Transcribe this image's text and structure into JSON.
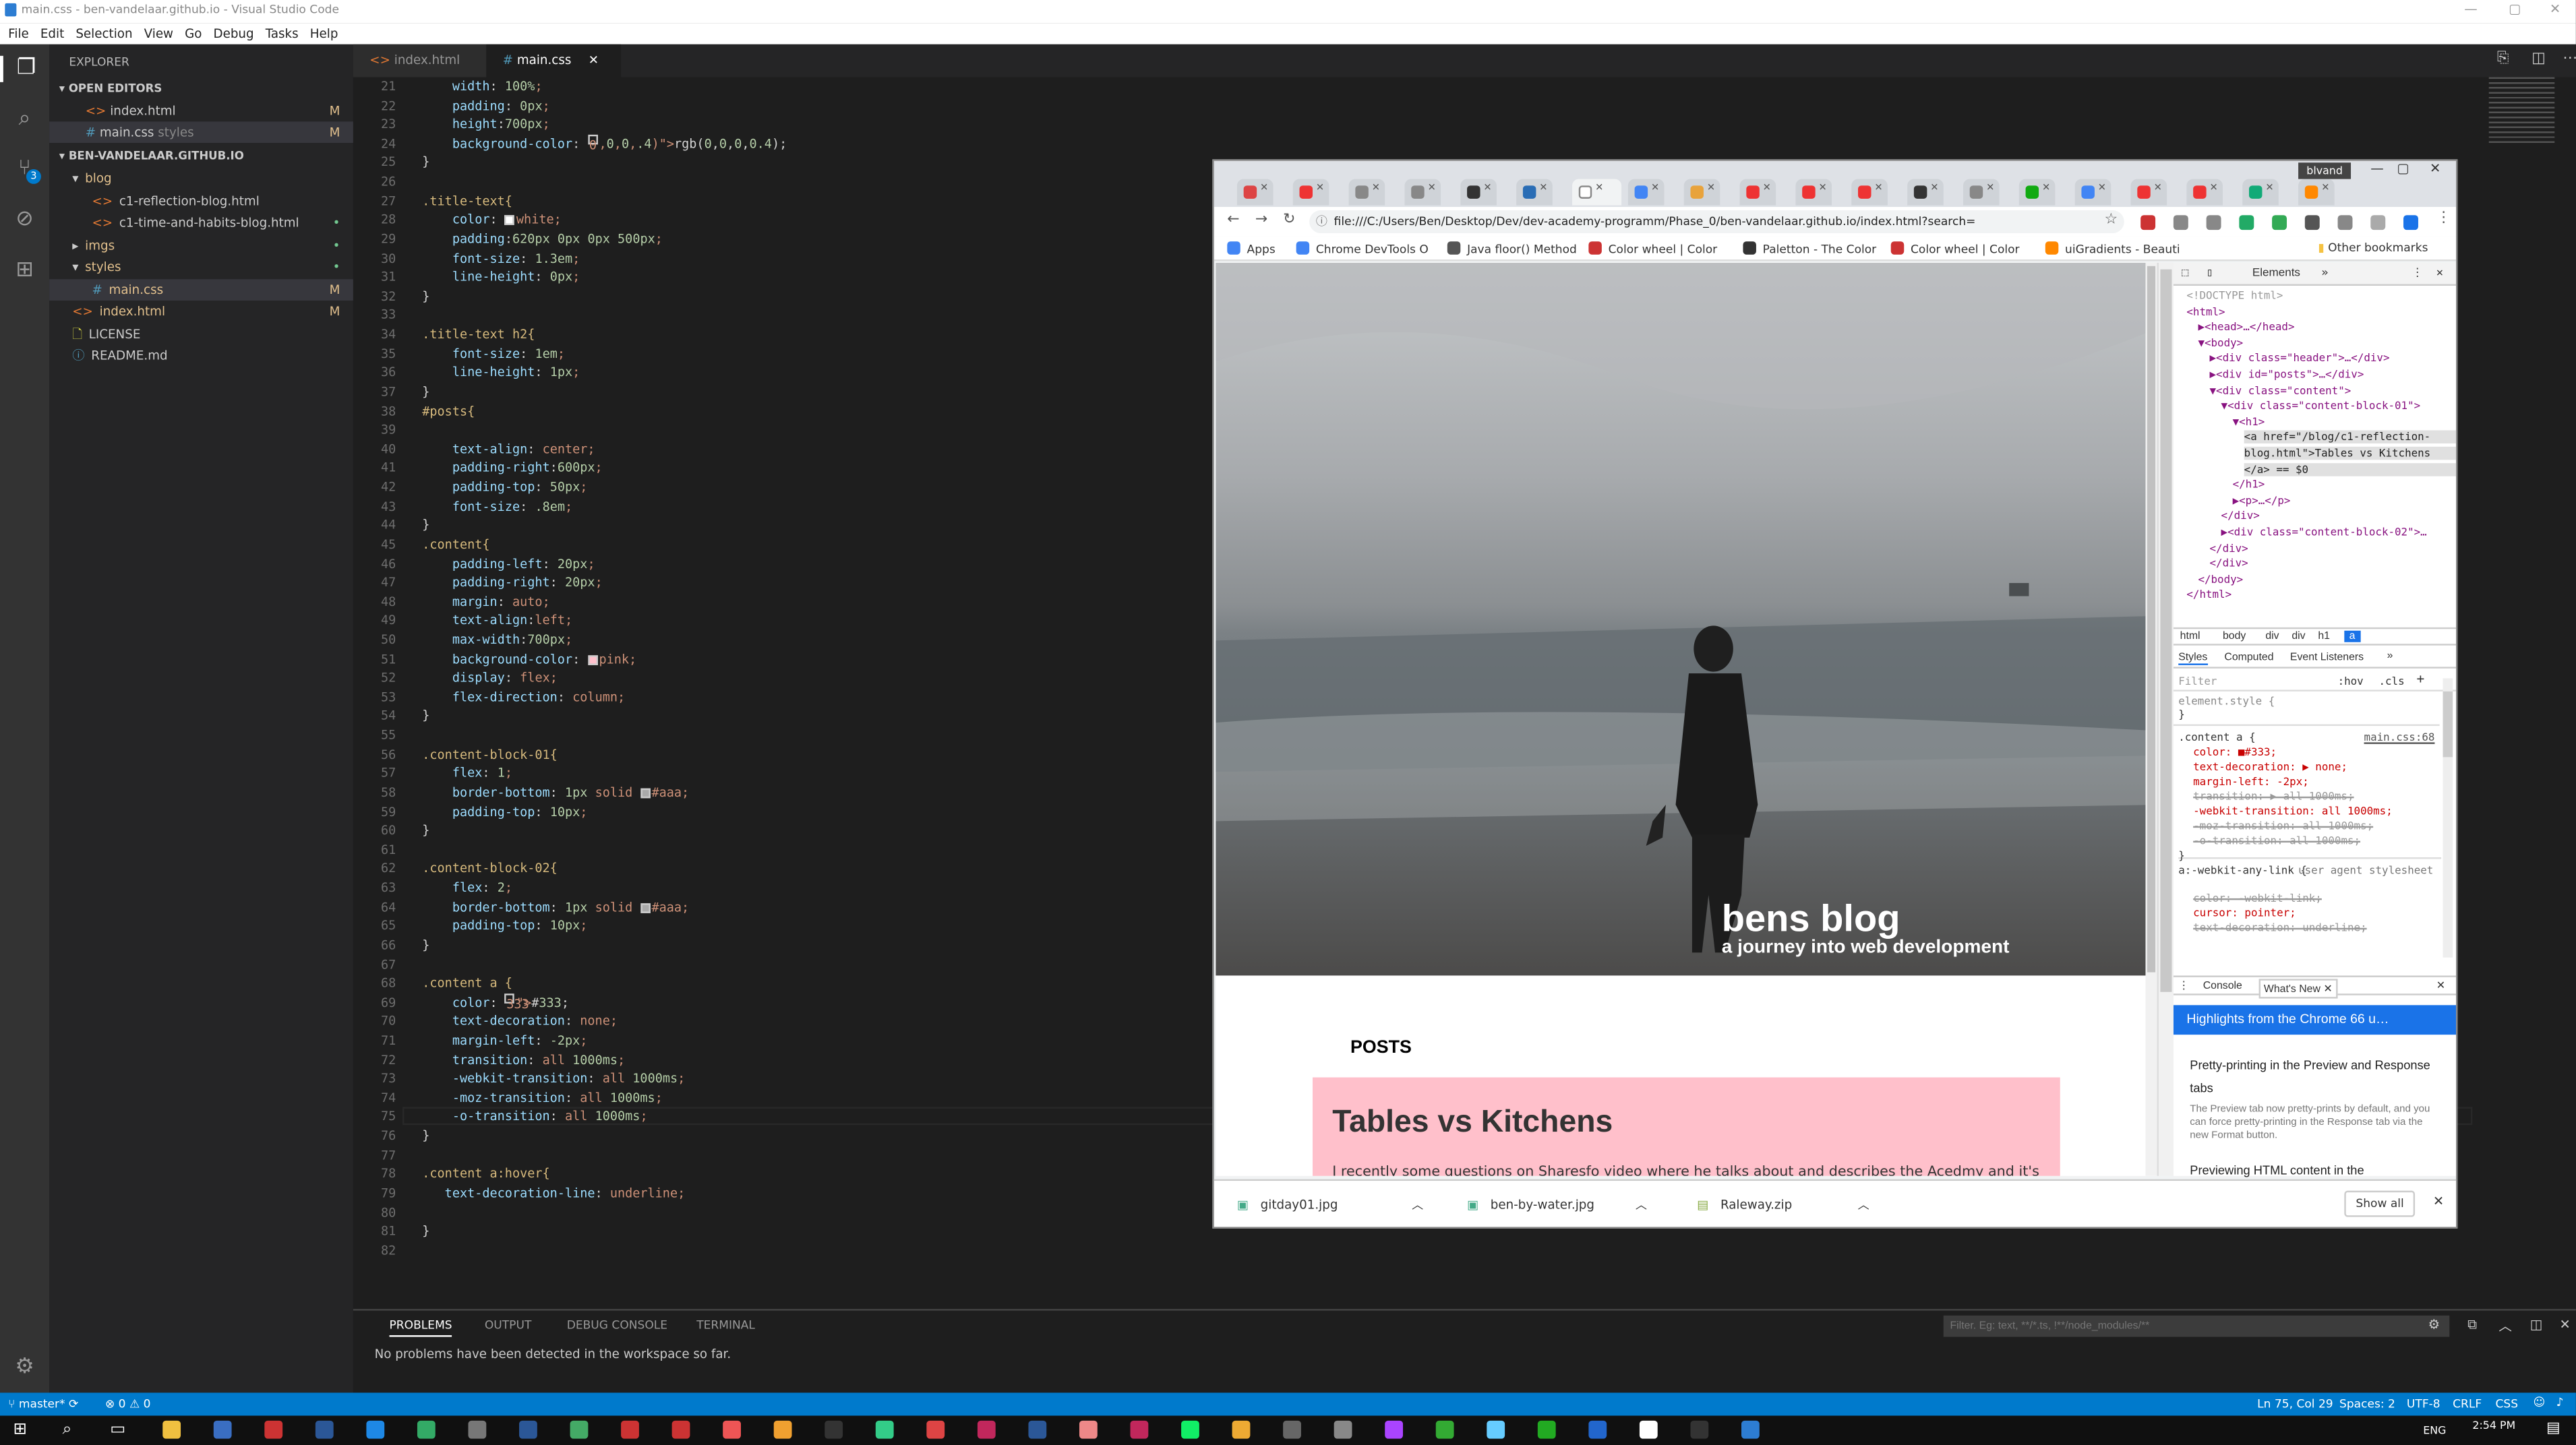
{
  "window": {
    "title": "main.css - ben-vandelaar.github.io - Visual Studio Code"
  },
  "menu": [
    "File",
    "Edit",
    "Selection",
    "View",
    "Go",
    "Debug",
    "Tasks",
    "Help"
  ],
  "sidebar": {
    "header": "EXPLORER",
    "open_editors_label": "OPEN EDITORS",
    "open_editors": [
      {
        "name": "index.html",
        "badge": "M"
      },
      {
        "name": "main.css",
        "hint": "styles",
        "badge": "M"
      }
    ],
    "project_label": "BEN-VANDELAAR.GITHUB.IO",
    "tree": [
      {
        "name": "blog",
        "kind": "folder",
        "depth": 0,
        "badge": ""
      },
      {
        "name": "c1-reflection-blog.html",
        "kind": "html",
        "depth": 1,
        "badge": ""
      },
      {
        "name": "c1-time-and-habits-blog.html",
        "kind": "html",
        "depth": 1,
        "badge": "•"
      },
      {
        "name": "imgs",
        "kind": "folder",
        "depth": 0,
        "badge": "•"
      },
      {
        "name": "styles",
        "kind": "folder",
        "depth": 0,
        "badge": "•"
      },
      {
        "name": "main.css",
        "kind": "css",
        "depth": 1,
        "badge": "M"
      },
      {
        "name": "index.html",
        "kind": "html",
        "depth": 0,
        "badge": "M"
      },
      {
        "name": "LICENSE",
        "kind": "file",
        "depth": 0,
        "badge": ""
      },
      {
        "name": "README.md",
        "kind": "md",
        "depth": 0,
        "badge": ""
      }
    ]
  },
  "editor": {
    "tabs": [
      {
        "label": "index.html",
        "active": false
      },
      {
        "label": "main.css",
        "active": true
      }
    ],
    "lines": [
      {
        "n": "21",
        "t": "    width: 100%;"
      },
      {
        "n": "22",
        "t": "    padding: 0px;"
      },
      {
        "n": "23",
        "t": "    height:700px;"
      },
      {
        "n": "24",
        "t": "    background-color: ■rgb(0,0,0,0.4);"
      },
      {
        "n": "25",
        "t": "}"
      },
      {
        "n": "26",
        "t": ""
      },
      {
        "n": "27",
        "t": ".title-text{"
      },
      {
        "n": "28",
        "t": "    color: □white;"
      },
      {
        "n": "29",
        "t": "    padding:620px 0px 0px 500px;"
      },
      {
        "n": "30",
        "t": "    font-size: 1.3em;"
      },
      {
        "n": "31",
        "t": "    line-height: 0px;"
      },
      {
        "n": "32",
        "t": "}"
      },
      {
        "n": "33",
        "t": ""
      },
      {
        "n": "34",
        "t": ".title-text h2{"
      },
      {
        "n": "35",
        "t": "    font-size: 1em;"
      },
      {
        "n": "36",
        "t": "    line-height: 1px;"
      },
      {
        "n": "37",
        "t": "}"
      },
      {
        "n": "38",
        "t": "#posts{"
      },
      {
        "n": "39",
        "t": ""
      },
      {
        "n": "40",
        "t": "    text-align: center;"
      },
      {
        "n": "41",
        "t": "    padding-right:600px;"
      },
      {
        "n": "42",
        "t": "    padding-top: 50px;"
      },
      {
        "n": "43",
        "t": "    font-size: .8em;"
      },
      {
        "n": "44",
        "t": "}"
      },
      {
        "n": "45",
        "t": ".content{"
      },
      {
        "n": "46",
        "t": "    padding-left: 20px;"
      },
      {
        "n": "47",
        "t": "    padding-right: 20px;"
      },
      {
        "n": "48",
        "t": "    margin: auto;"
      },
      {
        "n": "49",
        "t": "    text-align:left;"
      },
      {
        "n": "50",
        "t": "    max-width:700px;"
      },
      {
        "n": "51",
        "t": "    background-color: □pink;"
      },
      {
        "n": "52",
        "t": "    display: flex;"
      },
      {
        "n": "53",
        "t": "    flex-direction: column;"
      },
      {
        "n": "54",
        "t": "}"
      },
      {
        "n": "55",
        "t": ""
      },
      {
        "n": "56",
        "t": ".content-block-01{"
      },
      {
        "n": "57",
        "t": "    flex: 1;"
      },
      {
        "n": "58",
        "t": "    border-bottom: 1px solid □#aaa;"
      },
      {
        "n": "59",
        "t": "    padding-top: 10px;"
      },
      {
        "n": "60",
        "t": "}"
      },
      {
        "n": "61",
        "t": ""
      },
      {
        "n": "62",
        "t": ".content-block-02{"
      },
      {
        "n": "63",
        "t": "    flex: 2;"
      },
      {
        "n": "64",
        "t": "    border-bottom: 1px solid □#aaa;"
      },
      {
        "n": "65",
        "t": "    padding-top: 10px;"
      },
      {
        "n": "66",
        "t": "}"
      },
      {
        "n": "67",
        "t": ""
      },
      {
        "n": "68",
        "t": ".content a {"
      },
      {
        "n": "69",
        "t": "    color: □#333;"
      },
      {
        "n": "70",
        "t": "    text-decoration: none;"
      },
      {
        "n": "71",
        "t": "    margin-left: -2px;"
      },
      {
        "n": "72",
        "t": "    transition: all 1000ms;"
      },
      {
        "n": "73",
        "t": "    -webkit-transition: all 1000ms;"
      },
      {
        "n": "74",
        "t": "    -moz-transition: all 1000ms;"
      },
      {
        "n": "75",
        "t": "    -o-transition: all 1000ms;"
      },
      {
        "n": "76",
        "t": "}"
      },
      {
        "n": "77",
        "t": ""
      },
      {
        "n": "78",
        "t": ".content a:hover{"
      },
      {
        "n": "79",
        "t": "   text-decoration-line: underline;"
      },
      {
        "n": "80",
        "t": ""
      },
      {
        "n": "81",
        "t": "}"
      },
      {
        "n": "82",
        "t": ""
      }
    ]
  },
  "panel": {
    "tabs": [
      "PROBLEMS",
      "OUTPUT",
      "DEBUG CONSOLE",
      "TERMINAL"
    ],
    "message": "No problems have been detected in the workspace so far.",
    "filter_placeholder": "Filter. Eg: text, **/*.ts, !**/node_modules/**"
  },
  "statusbar": {
    "branch": "master*",
    "problems": "⊗ 0 ⚠ 0",
    "position": "Ln 75, Col 29",
    "spaces": "Spaces: 2",
    "encoding": "UTF-8",
    "eol": "CRLF",
    "language": "CSS"
  },
  "taskbar": {
    "time": "2:54 PM",
    "lang": "ENG"
  },
  "chrome": {
    "profile": "blvand",
    "url": "file:///C:/Users/Ben/Desktop/Dev/dev-academy-programm/Phase_0/ben-vandelaar.github.io/index.html?search=",
    "bookmarks": [
      "Apps",
      "Chrome DevTools O",
      "Java floor() Method",
      "Color wheel | Color",
      "Paletton - The Color",
      "Color wheel | Color",
      "uiGradients - Beauti"
    ],
    "other_bookmarks": "Other bookmarks",
    "page": {
      "title": "bens blog",
      "subtitle": "a journey into web development",
      "posts_heading": "POSTS",
      "post_title": "Tables vs Kitchens",
      "post_snippet": "I recently some questions on Sharesfo video where he talks about and describes the Acedmy and it's"
    },
    "downloads": [
      "gitday01.jpg",
      "ben-by-water.jpg",
      "Raleway.zip"
    ],
    "show_all": "Show all"
  },
  "devtools": {
    "tab": "Elements",
    "dom": [
      "<!DOCTYPE html>",
      "<html>",
      "▶<head>…</head>",
      "▼<body>",
      "▶<div class=\"header\">…</div>",
      "▶<div id=\"posts\">…</div>",
      "▼<div class=\"content\">",
      "▼<div class=\"content-block-01\">",
      "▼<h1>",
      "<a href=\"/blog/c1-reflection-",
      "blog.html\">Tables vs Kitchens",
      "</a> == $0",
      "</h1>",
      "▶<p>…</p>",
      "</div>",
      "▶<div class=\"content-block-02\">…",
      "</div>",
      "</div>",
      "</body>",
      "</html>"
    ],
    "breadcrumbs": [
      "html",
      "body",
      "div",
      "div",
      "h1",
      "a"
    ],
    "style_tabs": [
      "Styles",
      "Computed",
      "Event Listeners"
    ],
    "filter": "Filter",
    "hov": ":hov",
    "cls": ".cls",
    "element_style": "element.style {",
    "rule_selector": ".content a {",
    "rule_source": "main.css:68",
    "rule_props": [
      "color: ■#333;",
      "text-decoration: ▶ none;",
      "margin-left: -2px;",
      "transition: ▶ all 1000ms;",
      "-webkit-transition: all 1000ms;",
      "-moz-transition: all 1000ms;",
      "-o-transition: all 1000ms;"
    ],
    "ua_selector": "a:-webkit-any-link {",
    "ua_label": "user agent stylesheet",
    "ua_props": [
      "color: -webkit-link;",
      "cursor: pointer;",
      "text-decoration: underline;"
    ],
    "drawer_tabs": [
      "Console",
      "What's New"
    ],
    "whats_new_title": "Highlights from the Chrome 66 u…",
    "whats_new_item1": "Pretty-printing in the Preview and Response tabs",
    "whats_new_desc1": "The Preview tab now pretty-prints by default, and you can force pretty-printing in the Response tab via the new Format button.",
    "whats_new_item2": "Previewing HTML content in the"
  }
}
